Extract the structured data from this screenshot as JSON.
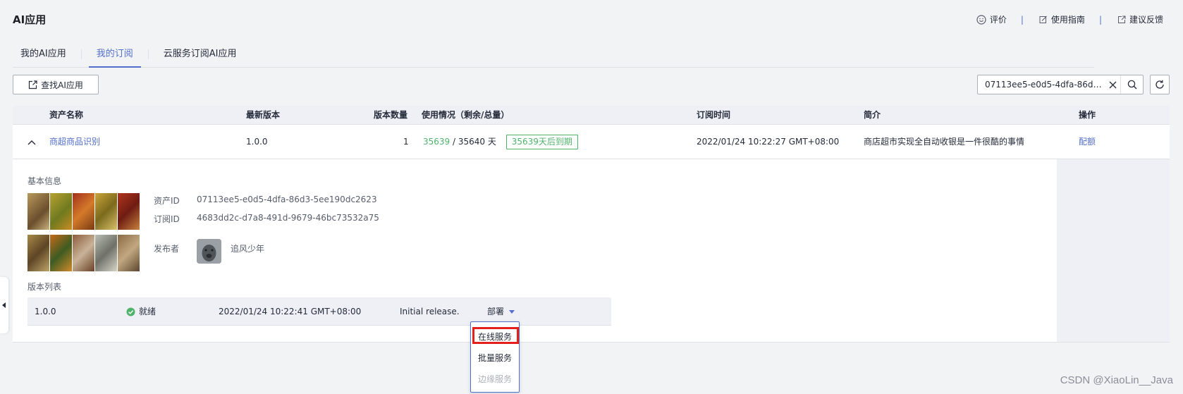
{
  "page": {
    "title": "AI应用"
  },
  "top_links": [
    {
      "label": "评价",
      "icon": "smile-icon"
    },
    {
      "label": "使用指南",
      "icon": "edit-doc-icon"
    },
    {
      "label": "建议反馈",
      "icon": "external-link-icon"
    }
  ],
  "tabs": [
    {
      "label": "我的AI应用",
      "active": false
    },
    {
      "label": "我的订阅",
      "active": true
    },
    {
      "label": "云服务订阅AI应用",
      "active": false
    }
  ],
  "toolbar": {
    "find_label": "查找AI应用"
  },
  "search": {
    "value": "07113ee5-e0d5-4dfa-86d3..."
  },
  "table": {
    "headers": [
      "资产名称",
      "最新版本",
      "版本数量",
      "使用情况（剩余/总量）",
      "订阅时间",
      "简介",
      "操作"
    ],
    "row": {
      "name": "商超商品识别",
      "latest_version": "1.0.0",
      "version_count": "1",
      "usage_remaining": "35639",
      "usage_sep": " / ",
      "usage_total": "35640 天",
      "expiry_badge": "35639天后到期",
      "subscribe_time": "2022/01/24 10:22:27 GMT+08:00",
      "description": "商店超市实现全自动收银是一件很酷的事情",
      "action": "配额"
    }
  },
  "detail": {
    "basic_title": "基本信息",
    "asset_id_label": "资产ID",
    "asset_id": "07113ee5-e0d5-4dfa-86d3-5ee190dc2623",
    "sub_id_label": "订阅ID",
    "sub_id": "4683dd2c-d7a8-491d-9679-46bc73532a75",
    "publisher_label": "发布者",
    "publisher": "追风少年",
    "version_list_title": "版本列表",
    "version": {
      "number": "1.0.0",
      "status": "就绪",
      "time": "2022/01/24 10:22:41 GMT+08:00",
      "note": "Initial release.",
      "deploy": "部署"
    }
  },
  "dropdown": {
    "items": [
      {
        "label": "在线服务",
        "disabled": false
      },
      {
        "label": "批量服务",
        "disabled": false
      },
      {
        "label": "边缘服务",
        "disabled": true
      }
    ]
  },
  "watermark": "CSDN @XiaoLin__Java",
  "colors": {
    "accent": "#526ecc",
    "success": "#50b36b",
    "highlight": "#e3201b"
  }
}
